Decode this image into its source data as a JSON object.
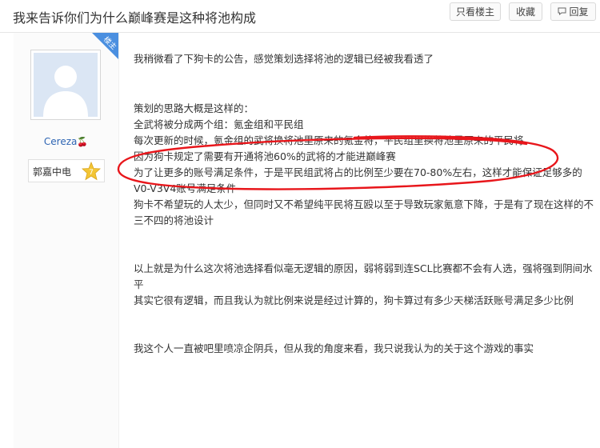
{
  "header": {
    "title": "我来告诉你们为什么巅峰赛是这种将池构成",
    "buttons": {
      "only_author": "只看楼主",
      "favorite": "收藏",
      "reply": "回复"
    }
  },
  "author": {
    "badge": "楼主",
    "username": "Cereza",
    "level_name": "郭嘉中电",
    "level_number": "7"
  },
  "post": {
    "paragraphs": [
      [
        "我稍微看了下狗卡的公告，感觉策划选择将池的逻辑已经被我看透了"
      ],
      [
        "策划的思路大概是这样的：",
        "全武将被分成两个组：氪金组和平民组",
        "每次更新的时候，氪金组的武将换将池里原来的氪金将，平民组里换将池里原来的平民将",
        "因为狗卡规定了需要有开通将池60%的武将的才能进巅峰赛",
        "为了让更多的账号满足条件，于是平民组武将占的比例至少要在70-80%左右，这样才能保证足够多的V0-V3V4账号满足条件",
        "狗卡不希望玩的人太少，但同时又不希望纯平民将互殴以至于导致玩家氪意下降，于是有了现在这样的不三不四的将池设计"
      ],
      [
        "以上就是为什么这次将池选择看似毫无逻辑的原因，弱将弱到连SCL比赛都不会有人选，强将强到阴间水平",
        "其实它很有逻辑，而且我认为就比例来说是经过计算的，狗卡算过有多少天梯活跃账号满足多少比例"
      ],
      [
        "我这个人一直被吧里喷凉企阴兵，但从我的角度来看，我只说我认为的关于这个游戏的事实"
      ]
    ]
  },
  "colors": {
    "accent_blue": "#4a8fe0",
    "username_blue": "#2d64b3",
    "circle_red": "#e8161b"
  }
}
